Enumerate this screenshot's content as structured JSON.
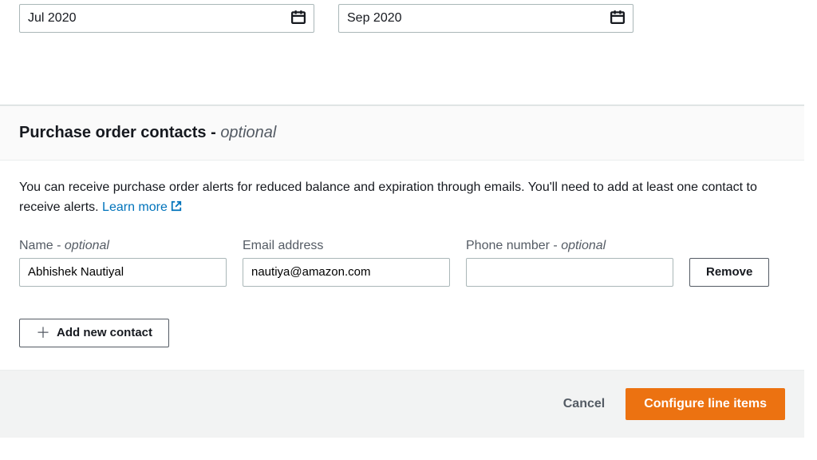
{
  "date_range": {
    "start": "Jul 2020",
    "end": "Sep 2020"
  },
  "contacts_section": {
    "title": "Purchase order contacts -",
    "title_optional": "optional",
    "helptext": "You can receive purchase order alerts for reduced balance and expiration through emails. You'll need to add at least one contact to receive alerts.",
    "learn_more": "Learn more",
    "fields": {
      "name_label": "Name -",
      "name_optional": "optional",
      "email_label": "Email address",
      "phone_label": "Phone number -",
      "phone_optional": "optional"
    },
    "row": {
      "name": "Abhishek Nautiyal",
      "email": "nautiya@amazon.com",
      "phone": ""
    },
    "remove_label": "Remove",
    "add_label": "Add new contact"
  },
  "footer": {
    "cancel": "Cancel",
    "primary": "Configure line items"
  }
}
